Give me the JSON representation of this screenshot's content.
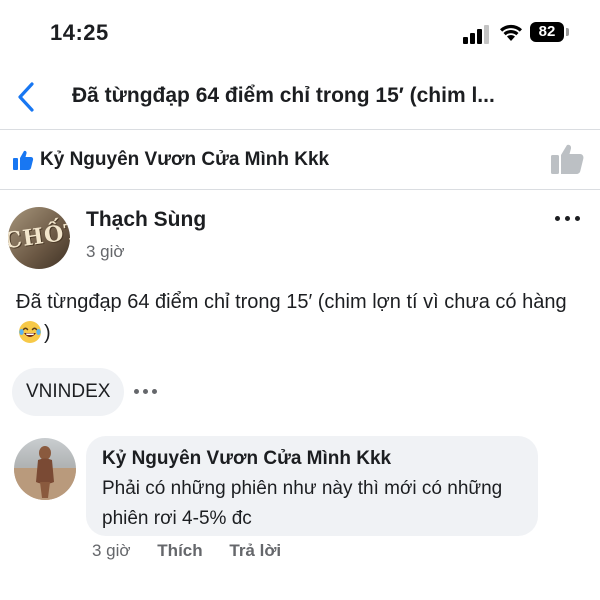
{
  "status_bar": {
    "time": "14:25",
    "battery": "82"
  },
  "nav": {
    "title": "Đã từngđạp 64 điểm chỉ trong 15′ (chim l..."
  },
  "group": {
    "name": "Kỷ Nguyên Vươn Cửa Mình Kkk"
  },
  "post": {
    "avatar_text": "CHỐT",
    "author": "Thạch Sùng",
    "time": "3 giờ",
    "body": "Đã từngđạp 64 điểm chỉ trong 15′ (chim lợn tí vì chưa có hàng",
    "body_end": ")",
    "tag": "VNINDEX"
  },
  "comment": {
    "author": "Kỷ Nguyên Vươn Cửa Mình Kkk",
    "text": "Phải có những phiên như này thì mới có những phiên rơi 4-5% đc",
    "time": "3 giờ",
    "like_label": "Thích",
    "reply_label": "Trả lời"
  },
  "colors": {
    "accent": "#1877f2",
    "text": "#1c1e21",
    "muted": "#65676b",
    "bubble": "#f0f2f5",
    "divider": "#dadde1"
  },
  "icons": [
    "signal-icon",
    "wifi-icon",
    "battery-icon",
    "back-chevron-icon",
    "thumbs-up-icon",
    "like-outline-icon",
    "more-icon",
    "laughing-emoji-icon"
  ]
}
